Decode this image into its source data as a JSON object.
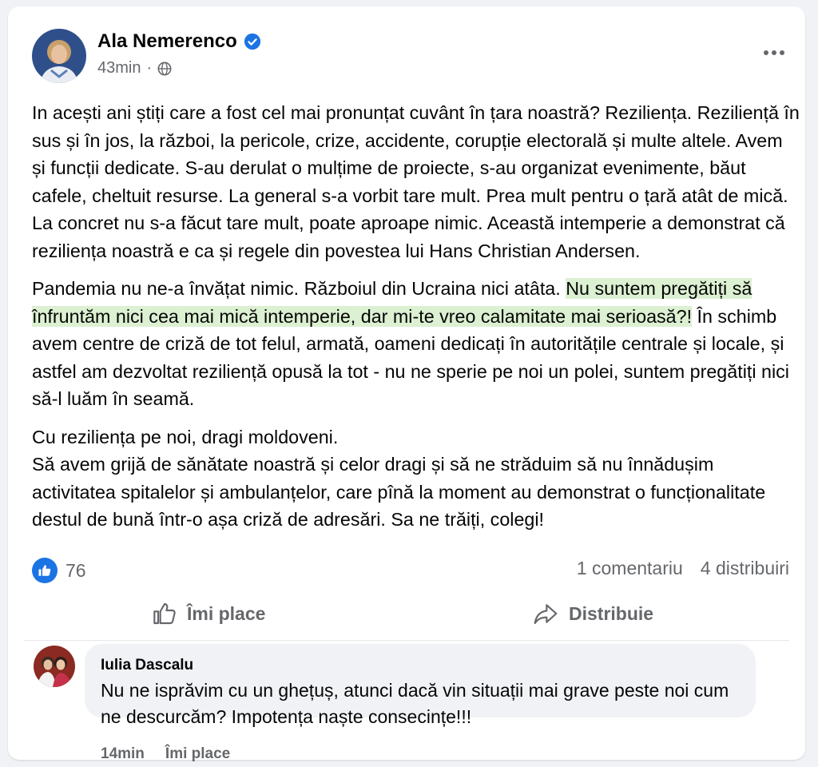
{
  "post": {
    "author": "Ala Nemerenco",
    "time": "43min",
    "separator": "·",
    "paragraphs": {
      "p1": "In acești ani știți care a fost cel mai pronunțat cuvânt în țara noastră? Reziliența. Reziliență în sus și în jos, la război, la pericole, crize, accidente, corupție electorală și multe altele. Avem și funcții dedicate. S-au derulat o mulțime de proiecte, s-au organizat evenimente, băut cafele, cheltuit resurse. La general s-a vorbit tare mult. Prea mult pentru o țară atât de mică. La concret nu s-a făcut tare mult, poate aproape nimic. Această intemperie a demonstrat că reziliența noastră e ca și regele din povestea lui Hans Christian Andersen.",
      "p2_before": "Pandemia nu ne-a învățat nimic. Războiul din Ucraina nici atâta. ",
      "p2_highlight": "Nu suntem pregătiți să înfruntăm nici cea mai mică intemperie, dar mi-te vreo calamitate mai serioasă?!",
      "p2_after": " În schimb avem centre de criză de tot felul, armată, oameni dedicați în autoritățile centrale și locale, și astfel am dezvoltat reziliență opusă la tot - nu ne sperie pe noi un polei, suntem pregătiți nici să-l luăm în seamă.",
      "p3_line1": "Cu reziliența pe noi, dragi moldoveni.",
      "p3_line2": "Să avem grijă de sănătate noastră și celor dragi și să ne străduim să nu înnădușim activitatea spitalelor și ambulanțelor, care pînă la moment au demonstrat o funcționalitate destul de bună într-o așa criză de adresări. Sa ne trăiți, colegi!"
    },
    "reaction_count": "76",
    "comments_count": "1 comentariu",
    "shares_count": "4 distribuiri"
  },
  "actions": {
    "like_label": "Îmi place",
    "share_label": "Distribuie"
  },
  "comment": {
    "author": "Iulia Dascalu",
    "text": "Nu ne isprăvim cu un ghețuș, atunci dacă vin situații mai grave peste noi cum ne descurcăm? Impotența naște consecințe!!!",
    "time": "14min",
    "like_label": "Îmi place"
  },
  "icons": {
    "verified": "verified-badge-icon",
    "globe": "globe-icon",
    "more": "more-options-icon",
    "like_reaction": "like-reaction-icon",
    "like_action": "thumbs-up-icon",
    "share_action": "share-arrow-icon"
  },
  "colors": {
    "accent": "#1b74e4",
    "highlight": "#dcf0d2",
    "secondary_text": "#65676b",
    "page_bg": "#f0f2f5"
  }
}
